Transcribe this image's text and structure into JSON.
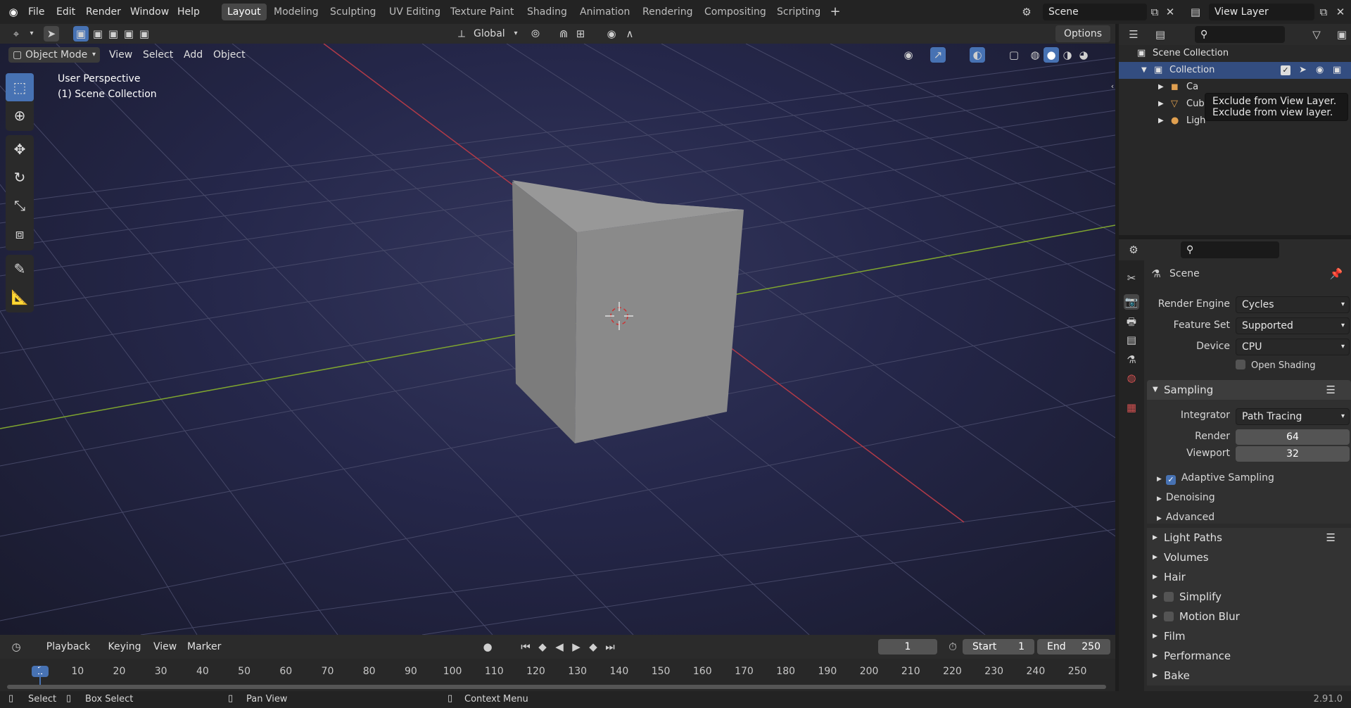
{
  "menu": [
    "File",
    "Edit",
    "Render",
    "Window",
    "Help"
  ],
  "workspaces": [
    {
      "label": "Layout",
      "active": true
    },
    {
      "label": "Modeling",
      "active": false
    },
    {
      "label": "Sculpting",
      "active": false
    },
    {
      "label": "UV Editing",
      "active": false
    },
    {
      "label": "Texture Paint",
      "active": false
    },
    {
      "label": "Shading",
      "active": false
    },
    {
      "label": "Animation",
      "active": false
    },
    {
      "label": "Rendering",
      "active": false
    },
    {
      "label": "Compositing",
      "active": false
    },
    {
      "label": "Scripting",
      "active": false
    }
  ],
  "scene_name": "Scene",
  "view_layer_name": "View Layer",
  "viewport": {
    "transform_orientation": "Global",
    "options_label": "Options",
    "mode": "Object Mode",
    "header_menus": [
      "View",
      "Select",
      "Add",
      "Object"
    ],
    "overlay_line1": "User Perspective",
    "overlay_line2": "(1) Scene Collection"
  },
  "outliner": {
    "root": "Scene Collection",
    "collection": "Collection",
    "items": [
      "Camera",
      "Cube",
      "Light"
    ],
    "items_visible": [
      "Ca",
      "Cub",
      "Ligh"
    ],
    "tooltip_title": "Exclude from View Layer.",
    "tooltip_desc": "Exclude from view layer."
  },
  "properties": {
    "context": "Scene",
    "render_engine_label": "Render Engine",
    "render_engine": "Cycles",
    "feature_set_label": "Feature Set",
    "feature_set": "Supported",
    "device_label": "Device",
    "device": "CPU",
    "osl_label": "Open Shading Langu...",
    "sampling": "Sampling",
    "integrator_label": "Integrator",
    "integrator": "Path Tracing",
    "render_label": "Render",
    "render_samples": "64",
    "viewport_label": "Viewport",
    "viewport_samples": "32",
    "adaptive_sampling": "Adaptive Sampling",
    "denoising": "Denoising",
    "advanced": "Advanced",
    "sections": [
      "Light Paths",
      "Volumes",
      "Hair",
      "Simplify",
      "Motion Blur",
      "Film",
      "Performance",
      "Bake"
    ]
  },
  "timeline": {
    "menus": [
      "Playback",
      "Keying",
      "View",
      "Marker"
    ],
    "current_frame": "1",
    "start_label": "Start",
    "start": "1",
    "end_label": "End",
    "end": "250",
    "ticks": [
      "1",
      "10",
      "20",
      "30",
      "40",
      "50",
      "60",
      "70",
      "80",
      "90",
      "100",
      "110",
      "120",
      "130",
      "140",
      "150",
      "160",
      "170",
      "180",
      "190",
      "200",
      "210",
      "220",
      "230",
      "240",
      "250"
    ]
  },
  "statusbar": {
    "select": "Select",
    "box_select": "Box Select",
    "pan_view": "Pan View",
    "context_menu": "Context Menu",
    "version": "2.91.0"
  },
  "colors": {
    "accent": "#4772b3",
    "x_axis": "#b13a48",
    "y_axis": "#7fa52f"
  }
}
